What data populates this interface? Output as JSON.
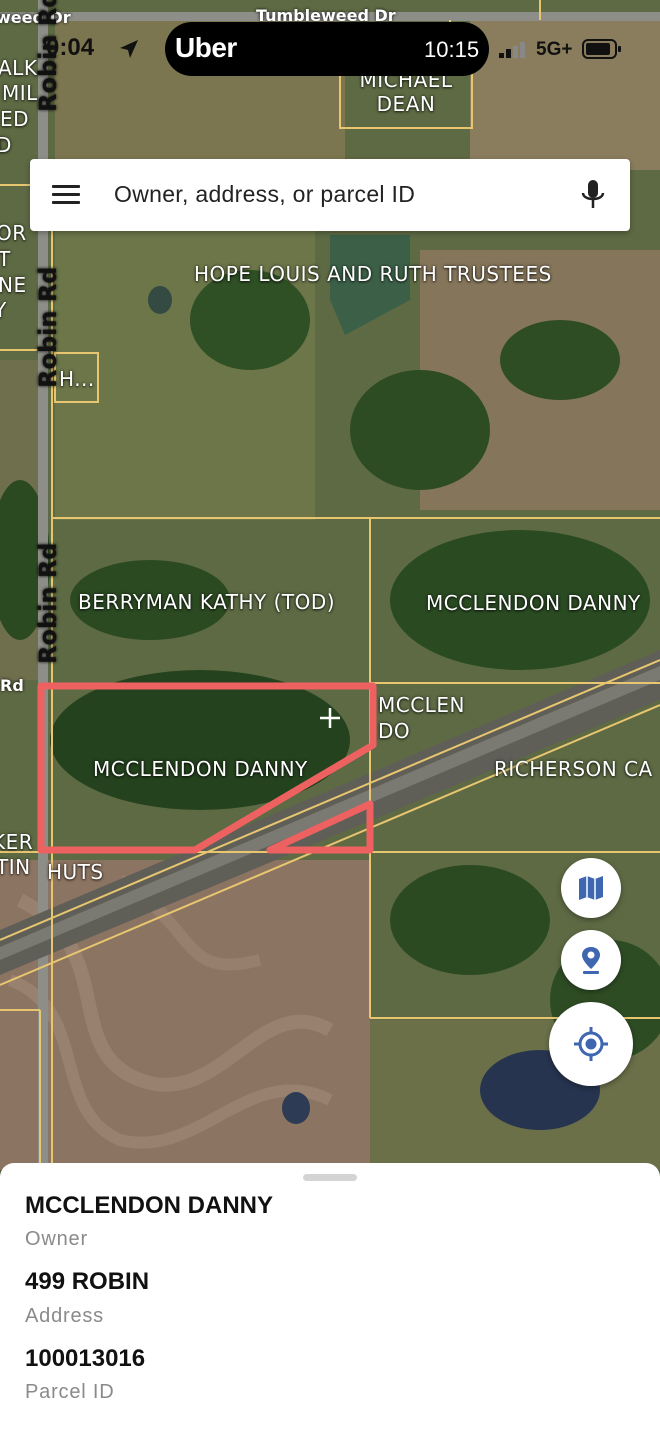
{
  "status_bar": {
    "time_left": "0:04",
    "app_name": "Uber",
    "time_right": "10:15",
    "network": "5G+"
  },
  "search": {
    "placeholder": "Owner, address, or parcel ID"
  },
  "map": {
    "parcel_labels": [
      "MICHAEL DEAN",
      "HOPE LOUIS AND RUTH TRUSTEES",
      "H...",
      "BERRYMAN KATHY (TOD)",
      "MCCLENDON DANNY",
      "MCCLEN",
      "DO",
      "MCCLENDON DANNY",
      "RICHERSON CA",
      "HUTS"
    ],
    "road_labels": [
      "weed Dr",
      "Tumbleweed Dr",
      "Robin Rd",
      "Robin Rd",
      "Robin Rd",
      "Rd"
    ],
    "edge_labels": [
      "ALK",
      "MIL",
      "ED",
      "D",
      "OR",
      "T",
      "NE",
      "Y",
      "KER",
      "TIN"
    ]
  },
  "detail": {
    "owner_value": "MCCLENDON DANNY",
    "owner_label": "Owner",
    "address_value": "499 ROBIN",
    "address_label": "Address",
    "parcel_value": "100013016",
    "parcel_label": "Parcel ID"
  },
  "colors": {
    "parcel_line": "#e8c670",
    "selected_parcel": "#ee6161",
    "fab_icon": "#3f66b0"
  },
  "icons": [
    "menu-icon",
    "microphone-icon",
    "map-layers-icon",
    "location-pin-icon",
    "my-location-icon",
    "crosshair-icon",
    "navigation-arrow-icon"
  ]
}
